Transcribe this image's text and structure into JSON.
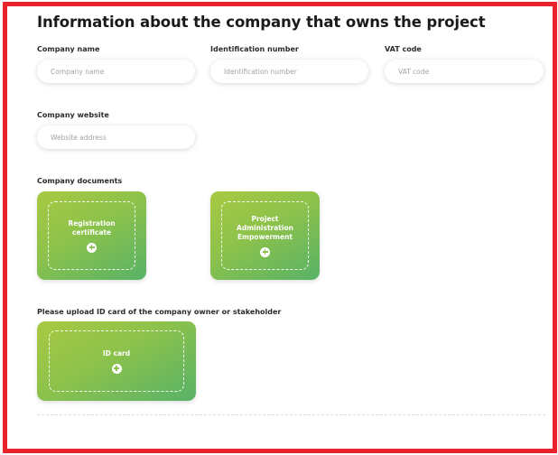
{
  "section": {
    "title": "Information about the company that owns the project"
  },
  "fields": {
    "company_name": {
      "label": "Company name",
      "placeholder": "Company name",
      "value": ""
    },
    "identification_number": {
      "label": "Identification number",
      "placeholder": "Identification number",
      "value": ""
    },
    "vat_code": {
      "label": "VAT code",
      "placeholder": "VAT code",
      "value": ""
    },
    "company_website": {
      "label": "Company website",
      "placeholder": "Website address",
      "value": ""
    }
  },
  "documents": {
    "label": "Company documents",
    "cards": [
      {
        "label": "Registration certificate",
        "icon": "plus-circle-icon"
      },
      {
        "label": "Project Administration Empowerment",
        "icon": "plus-circle-icon"
      }
    ]
  },
  "id_upload": {
    "label": "Please upload ID card of the company owner or stakeholder",
    "card": {
      "label": "ID card",
      "icon": "plus-circle-icon"
    }
  },
  "colors": {
    "frame_border": "#e8232c",
    "card_gradient_start": "#a9c943",
    "card_gradient_end": "#58b267"
  }
}
